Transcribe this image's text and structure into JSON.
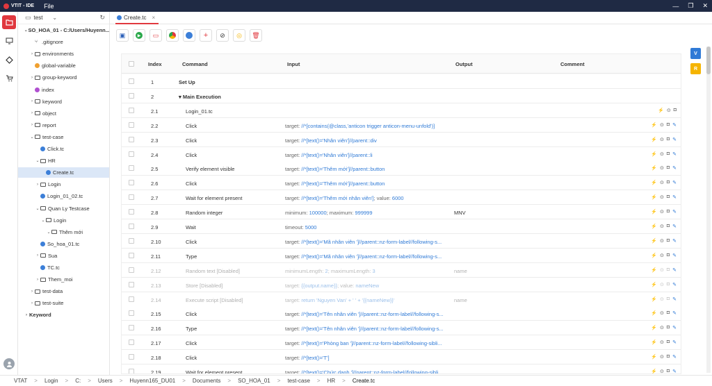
{
  "app": {
    "title": "VTIT - IDE",
    "menu_file": "File"
  },
  "window": {
    "min": "—",
    "restore": "❐",
    "close": "✕"
  },
  "workspace": {
    "name": "test"
  },
  "tree": [
    {
      "label": "SO_HOA_01 - C:/Users/Huyenn...",
      "depth": 0,
      "icon": "chev-open",
      "bold": true
    },
    {
      "label": ".gitignore",
      "depth": 1,
      "icon": "git"
    },
    {
      "label": "environments",
      "depth": 1,
      "icon": "folder-closed"
    },
    {
      "label": "global-variable",
      "depth": 1,
      "icon": "gv"
    },
    {
      "label": "group-keyword",
      "depth": 1,
      "icon": "folder-closed"
    },
    {
      "label": "index",
      "depth": 1,
      "icon": "ix"
    },
    {
      "label": "keyword",
      "depth": 1,
      "icon": "folder-closed"
    },
    {
      "label": "object",
      "depth": 1,
      "icon": "folder-closed"
    },
    {
      "label": "report",
      "depth": 1,
      "icon": "folder-closed"
    },
    {
      "label": "test-case",
      "depth": 1,
      "icon": "folder-open"
    },
    {
      "label": "Click.tc",
      "depth": 2,
      "icon": "tc"
    },
    {
      "label": "HR",
      "depth": 2,
      "icon": "folder-open"
    },
    {
      "label": "Create.tc",
      "depth": 3,
      "icon": "tc",
      "selected": true
    },
    {
      "label": "Login",
      "depth": 2,
      "icon": "folder-closed"
    },
    {
      "label": "Login_01_02.tc",
      "depth": 2,
      "icon": "tc"
    },
    {
      "label": "Quan Ly Testcase",
      "depth": 2,
      "icon": "folder-open"
    },
    {
      "label": "Login",
      "depth": 3,
      "icon": "folder-open"
    },
    {
      "label": "Thêm mới",
      "depth": 4,
      "icon": "folder-open"
    },
    {
      "label": "So_hoa_01.tc",
      "depth": 2,
      "icon": "tc"
    },
    {
      "label": "Sua",
      "depth": 2,
      "icon": "folder-closed"
    },
    {
      "label": "TC.tc",
      "depth": 2,
      "icon": "tc"
    },
    {
      "label": "Them_moi",
      "depth": 2,
      "icon": "folder-closed"
    },
    {
      "label": "test-data",
      "depth": 1,
      "icon": "folder-closed"
    },
    {
      "label": "test-suite",
      "depth": 1,
      "icon": "folder-closed"
    },
    {
      "label": "Keyword",
      "depth": 0,
      "icon": "chev-closed",
      "bold": true
    }
  ],
  "tab": {
    "label": "Create.tc"
  },
  "table": {
    "headers": {
      "index": "Index",
      "command": "Command",
      "input": "Input",
      "output": "Output",
      "comment": "Comment"
    },
    "rows": [
      {
        "index": "1",
        "command": "Set Up",
        "input": [],
        "output": "",
        "bold": true
      },
      {
        "index": "2",
        "command": "▾ Main Execution",
        "input": [],
        "output": "",
        "bold": true
      },
      {
        "index": "2.1",
        "command": "Login_01.tc",
        "input": [],
        "output": "",
        "actions": "nested"
      },
      {
        "index": "2.2",
        "command": "Click",
        "input": [
          [
            "target:",
            "//*[contains(@class,'anticon trigger anticon-menu-unfold')]"
          ]
        ],
        "output": ""
      },
      {
        "index": "2.3",
        "command": "Click",
        "input": [
          [
            "target:",
            "//*[text()='Nhân viên']//parent::div"
          ]
        ],
        "output": ""
      },
      {
        "index": "2.4",
        "command": "Click",
        "input": [
          [
            "target:",
            "//*[text()='Nhân viên']//parent::li"
          ]
        ],
        "output": ""
      },
      {
        "index": "2.5",
        "command": "Verify element visible",
        "input": [
          [
            "target:",
            "//*[text()='Thêm mới']//parent::button"
          ]
        ],
        "output": ""
      },
      {
        "index": "2.6",
        "command": "Click",
        "input": [
          [
            "target:",
            "//*[text()='Thêm mới']//parent::button"
          ]
        ],
        "output": ""
      },
      {
        "index": "2.7",
        "command": "Wait for element present",
        "input": [
          [
            "target:",
            "//*[text()='Thêm mới nhân viên']"
          ],
          [
            "; value:",
            "6000"
          ]
        ],
        "output": ""
      },
      {
        "index": "2.8",
        "command": "Random integer",
        "input": [
          [
            "minimum:",
            "100000"
          ],
          [
            "; maximum:",
            "999999"
          ]
        ],
        "output": "MNV"
      },
      {
        "index": "2.9",
        "command": "Wait",
        "input": [
          [
            "timeout:",
            "5000"
          ]
        ],
        "output": ""
      },
      {
        "index": "2.10",
        "command": "Click",
        "input": [
          [
            "target:",
            "//*[text()='Mã nhân viên ']//parent::nz-form-label//following-s..."
          ]
        ],
        "output": ""
      },
      {
        "index": "2.11",
        "command": "Type",
        "input": [
          [
            "target:",
            "//*[text()='Mã nhân viên ']//parent::nz-form-label//following-s..."
          ]
        ],
        "output": ""
      },
      {
        "index": "2.12",
        "command": "Random text [Disabled]",
        "input": [
          [
            "minimumLength:",
            "2"
          ],
          [
            "; maximumLength:",
            "3"
          ]
        ],
        "output": "name",
        "disabled": true
      },
      {
        "index": "2.13",
        "command": "Store [Disabled]",
        "input": [
          [
            "target:",
            "{{output.name}}"
          ],
          [
            "; value:",
            "nameNew"
          ]
        ],
        "output": "",
        "disabled": true
      },
      {
        "index": "2.14",
        "command": "Execute script [Disabled]",
        "input": [
          [
            "target:",
            "return 'Nguyen Van' + ' ' + '{{nameNew}}'"
          ]
        ],
        "output": "name",
        "disabled": true
      },
      {
        "index": "2.15",
        "command": "Click",
        "input": [
          [
            "target:",
            "//*[text()='Tên nhân viên ']//parent::nz-form-label//following-s..."
          ]
        ],
        "output": ""
      },
      {
        "index": "2.16",
        "command": "Type",
        "input": [
          [
            "target:",
            "//*[text()='Tên nhân viên ']//parent::nz-form-label//following-s..."
          ]
        ],
        "output": ""
      },
      {
        "index": "2.17",
        "command": "Click",
        "input": [
          [
            "target:",
            "//*[text()='Phòng ban ']//parent::nz-form-label//following-sibli..."
          ]
        ],
        "output": ""
      },
      {
        "index": "2.18",
        "command": "Click",
        "input": [
          [
            "target:",
            "//*[text()='T']"
          ]
        ],
        "output": ""
      },
      {
        "index": "2.19",
        "command": "Wait for element present",
        "input": [
          [
            "target:",
            "//*[text()='Chức danh ']//parent::nz-form-label//following-sibli..."
          ]
        ],
        "output": ""
      }
    ]
  },
  "right_badges": [
    {
      "label": "V",
      "color": "#2f7ad6"
    },
    {
      "label": "R",
      "color": "#f5b400"
    }
  ],
  "breadcrumbs": [
    "VTAT",
    "Login",
    "C:",
    "Users",
    "Huyenn165_DU01",
    "Documents",
    "SO_HOA_01",
    "test-case",
    "HR",
    "Create.tc"
  ],
  "colors": {
    "accent": "#e0383e",
    "link": "#2f7ad6",
    "titlebar": "#1f2a44"
  }
}
